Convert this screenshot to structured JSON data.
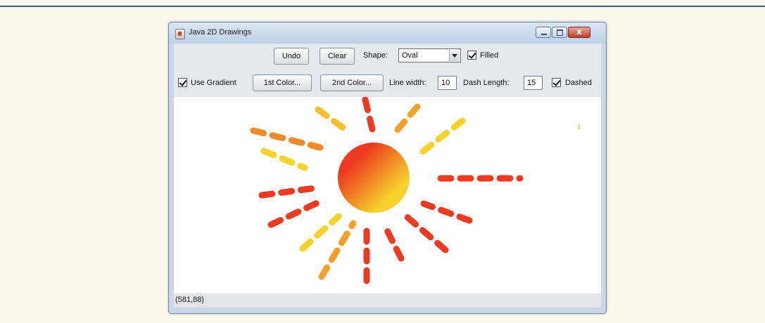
{
  "window": {
    "title": "Java 2D Drawings",
    "close_glyph": "x"
  },
  "toolbar": {
    "undo_label": "Undo",
    "clear_label": "Clear",
    "shape_label": "Shape:",
    "shape_value": "Oval",
    "filled_label": "Filled",
    "filled_checked": true,
    "gradient_label": "Use Gradient",
    "gradient_checked": true,
    "color1_label": "1st Color...",
    "color2_label": "2nd Color...",
    "line_width_label": "Line width:",
    "line_width_value": "10",
    "dash_length_label": "Dash Length:",
    "dash_length_value": "15",
    "dashed_label": "Dashed",
    "dashed_checked": true
  },
  "status": {
    "coords": "(581,88)"
  },
  "colors": {
    "gradient_start": "#ee3a20",
    "gradient_end": "#f5d22c",
    "window_frame": "#c9d7e8",
    "canvas_bg": "#ffffff"
  },
  "icons": [
    "java-app-icon",
    "minimize-icon",
    "maximize-icon",
    "close-icon",
    "dropdown-arrow-icon",
    "checkbox-check-icon"
  ]
}
